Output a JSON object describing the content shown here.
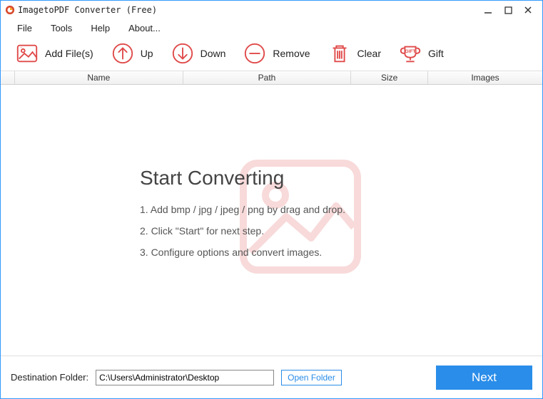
{
  "titlebar": {
    "title": "ImagetoPDF Converter (Free)"
  },
  "menu": {
    "file": "File",
    "tools": "Tools",
    "help": "Help",
    "about": "About..."
  },
  "toolbar": {
    "add": "Add File(s)",
    "up": "Up",
    "down": "Down",
    "remove": "Remove",
    "clear": "Clear",
    "gift": "Gift"
  },
  "columns": {
    "name": "Name",
    "path": "Path",
    "size": "Size",
    "images": "Images"
  },
  "instructions": {
    "heading": "Start Converting",
    "line1": "1. Add bmp / jpg / jpeg / png by drag and drop.",
    "line2": "2. Click \"Start\" for next step.",
    "line3": "3. Configure options and convert images."
  },
  "bottom": {
    "dest_label": "Destination Folder:",
    "dest_value": "C:\\Users\\Administrator\\Desktop",
    "open_folder": "Open Folder",
    "next": "Next"
  }
}
